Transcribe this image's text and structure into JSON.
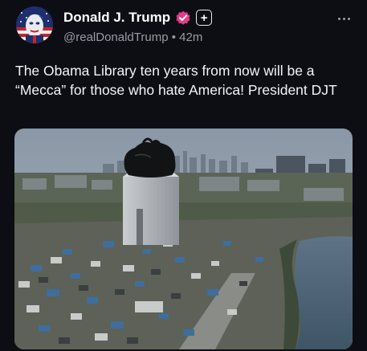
{
  "post": {
    "display_name": "Donald J. Trump",
    "handle": "@realDonaldTrump",
    "separator": "•",
    "time_ago": "42m",
    "follow_symbol": "+",
    "text": "The Obama Library ten years from now will be a “Mecca” for those who hate America! President DJT"
  },
  "icons": {
    "verified": "verified-badge-icon",
    "follow": "plus-icon",
    "more": "more-options-icon"
  },
  "colors": {
    "background": "#0d0d14",
    "verified_badge": "#e23b8a",
    "handle_text": "#9a9aa6"
  }
}
